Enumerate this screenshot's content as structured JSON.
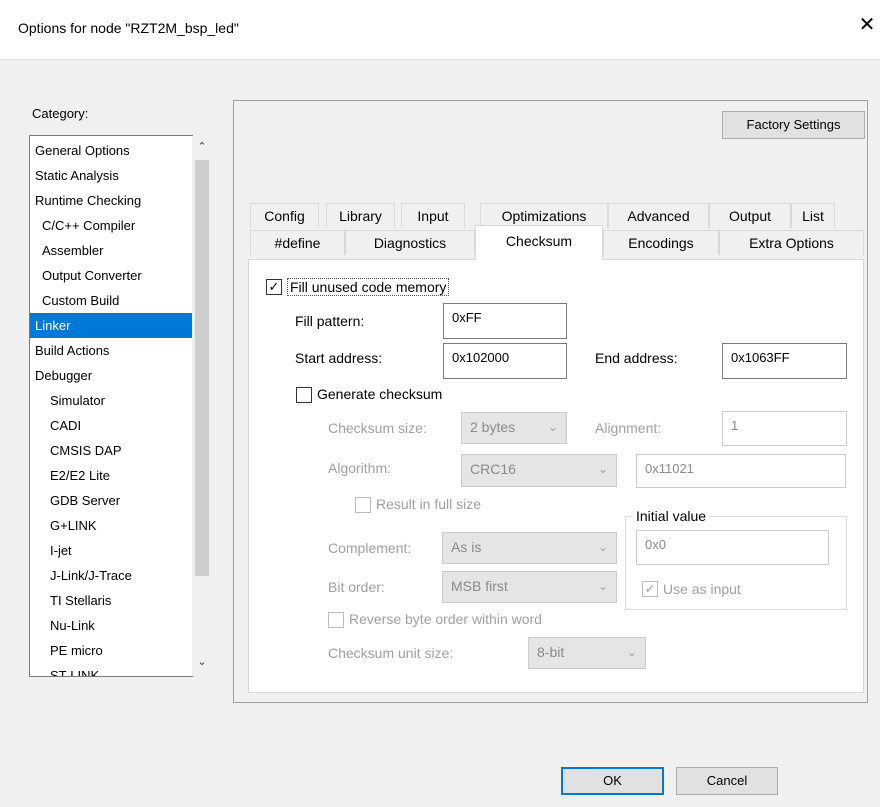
{
  "window": {
    "title": "Options for node \"RZT2M_bsp_led\"",
    "close_glyph": "✕"
  },
  "category": {
    "label": "Category:",
    "items": [
      "General Options",
      "Static Analysis",
      "Runtime Checking",
      "C/C++ Compiler",
      "Assembler",
      "Output Converter",
      "Custom Build",
      "Linker",
      "Build Actions",
      "Debugger",
      "Simulator",
      "CADI",
      "CMSIS DAP",
      "E2/E2 Lite",
      "GDB Server",
      "G+LINK",
      "I-jet",
      "J-Link/J-Trace",
      "TI Stellaris",
      "Nu-Link",
      "PE micro",
      "ST-LINK"
    ],
    "selected": "Linker"
  },
  "factory_settings": "Factory Settings",
  "tabs_row1": [
    "Config",
    "Library",
    "Input",
    "Optimizations",
    "Advanced",
    "Output",
    "List"
  ],
  "tabs_row2": [
    "#define",
    "Diagnostics",
    "Checksum",
    "Encodings",
    "Extra Options"
  ],
  "active_tab": "Checksum",
  "checksum": {
    "fill_unused": {
      "label": "Fill unused code memory",
      "checked": true
    },
    "fill_pattern": {
      "label": "Fill pattern:",
      "value": "0xFF"
    },
    "start_address": {
      "label": "Start address:",
      "value": "0x102000"
    },
    "end_address": {
      "label": "End address:",
      "value": "0x1063FF"
    },
    "generate_checksum": {
      "label": "Generate checksum",
      "checked": false
    },
    "checksum_size": {
      "label": "Checksum size:",
      "value": "2 bytes"
    },
    "alignment": {
      "label": "Alignment:",
      "value": "1"
    },
    "algorithm": {
      "label": "Algorithm:",
      "value": "CRC16",
      "poly": "0x11021"
    },
    "result_full_size": {
      "label": "Result in full size",
      "checked": false
    },
    "initial_value": {
      "legend": "Initial value",
      "value": "0x0",
      "use_as_input": "Use as input",
      "use_as_input_checked": true
    },
    "complement": {
      "label": "Complement:",
      "value": "As is"
    },
    "bit_order": {
      "label": "Bit order:",
      "value": "MSB first"
    },
    "reverse_byte": {
      "label": "Reverse byte order within word",
      "checked": false
    },
    "unit_size": {
      "label": "Checksum unit size:",
      "value": "8-bit"
    }
  },
  "buttons": {
    "ok": "OK",
    "cancel": "Cancel"
  },
  "icons": {
    "chevron": "chevron-down-icon",
    "check": "checkmark-icon"
  }
}
